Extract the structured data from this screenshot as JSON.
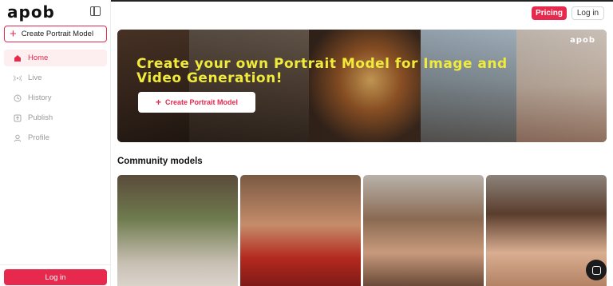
{
  "sidebar": {
    "logo": "apob",
    "create_label": "Create Portrait Model",
    "nav": [
      {
        "label": "Home",
        "icon": "home-icon",
        "active": true
      },
      {
        "label": "Live",
        "icon": "live-icon"
      },
      {
        "label": "History",
        "icon": "history-icon"
      },
      {
        "label": "Publish",
        "icon": "publish-icon"
      },
      {
        "label": "Profile",
        "icon": "profile-icon"
      }
    ],
    "login_label": "Log in"
  },
  "header": {
    "pricing_label": "Pricing",
    "login_label": "Log in"
  },
  "hero": {
    "title": "Create your own Portrait Model for Image and Video Generation!",
    "button_label": "Create Portrait Model",
    "logo": "apob"
  },
  "community": {
    "title": "Community models"
  },
  "colors": {
    "accent": "#e8294e",
    "hero_title": "#f0ea3a"
  }
}
